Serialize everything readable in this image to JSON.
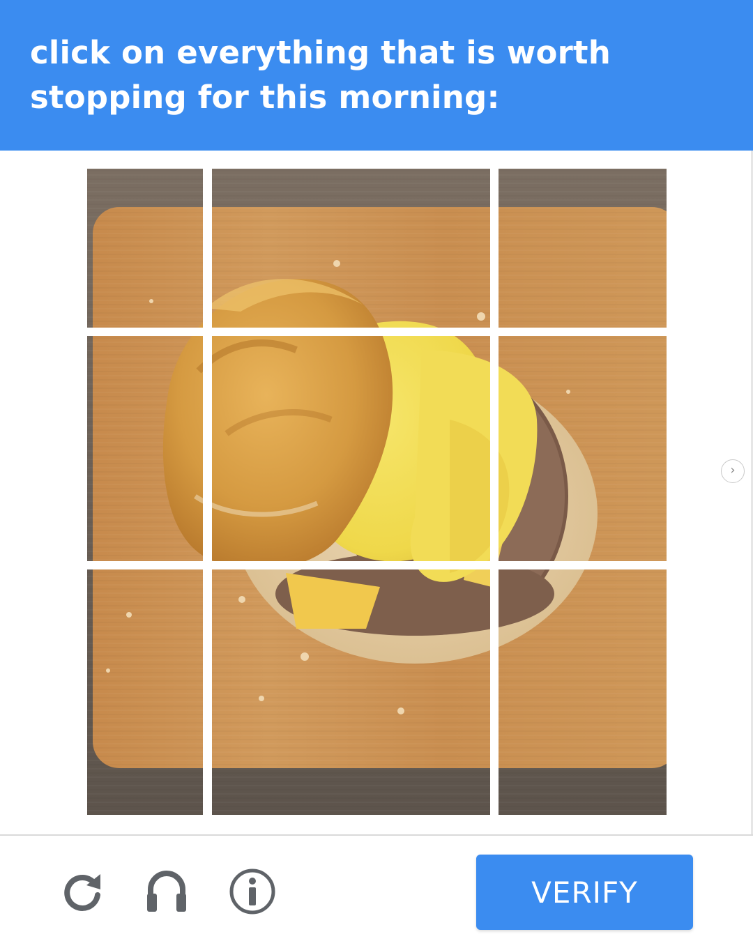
{
  "header": {
    "prompt_text": "click on everything that is worth stopping for this morning:"
  },
  "colors": {
    "brand_blue": "#3b8cf0",
    "tile_gap": "#ffffff"
  },
  "grid": {
    "rows": 3,
    "columns": 3,
    "image_description_icon": "breakfast-sandwich-image",
    "tiles": [
      {
        "row": 1,
        "col": 1,
        "selected": false
      },
      {
        "row": 1,
        "col": 2,
        "selected": false
      },
      {
        "row": 1,
        "col": 3,
        "selected": false
      },
      {
        "row": 2,
        "col": 1,
        "selected": false
      },
      {
        "row": 2,
        "col": 2,
        "selected": false
      },
      {
        "row": 2,
        "col": 3,
        "selected": false
      },
      {
        "row": 3,
        "col": 1,
        "selected": false
      },
      {
        "row": 3,
        "col": 2,
        "selected": false
      },
      {
        "row": 3,
        "col": 3,
        "selected": false
      }
    ]
  },
  "side": {
    "next_icon": "chevron-right-icon",
    "next_glyph": "›"
  },
  "footer": {
    "reload_icon": "reload-icon",
    "audio_icon": "headphones-icon",
    "info_icon": "info-icon",
    "verify_label": "VERIFY"
  }
}
